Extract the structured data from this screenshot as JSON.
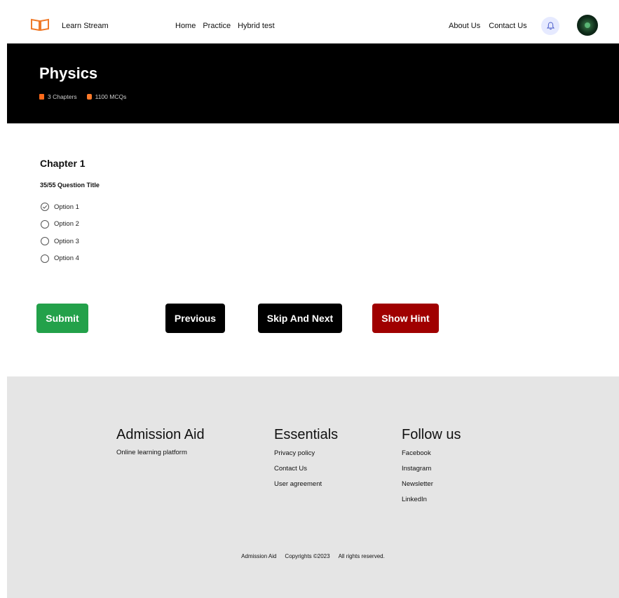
{
  "nav": {
    "brand": "Learn Stream",
    "links": [
      "Home",
      "Practice",
      "Hybrid test"
    ],
    "right_links": [
      "About Us",
      "Contact Us"
    ],
    "bell_icon": "bell-icon",
    "accent": "#e6eaff"
  },
  "hero": {
    "title": "Physics",
    "chapters": "3 Chapters",
    "mcqs": "1100 MCQs"
  },
  "question": {
    "chapter": "Chapter 1",
    "title": "35/55 Question Title",
    "options": [
      {
        "label": "Option 1",
        "checked": true
      },
      {
        "label": "Option 2",
        "checked": false
      },
      {
        "label": "Option 3",
        "checked": false
      },
      {
        "label": "Option 4",
        "checked": false
      }
    ]
  },
  "buttons": {
    "submit": "Submit",
    "previous": "Previous",
    "skip": "Skip And Next",
    "hint": "Show Hint",
    "colors": {
      "submit": "#23a14a",
      "previous": "#000000",
      "skip": "#000000",
      "hint": "#a00000"
    }
  },
  "footer": {
    "col1": {
      "title": "Admission Aid",
      "desc": "Online learning platform"
    },
    "col2": {
      "title": "Essentials",
      "links": [
        "Privacy policy",
        "Contact Us",
        "User agreement"
      ]
    },
    "col3": {
      "title": "Follow us",
      "links": [
        "Facebook",
        "Instagram",
        "Newsletter",
        "LinkedIn"
      ]
    },
    "copyright": [
      "Admission Aid",
      "Copyrights ©2023",
      "All rights reserved."
    ]
  }
}
